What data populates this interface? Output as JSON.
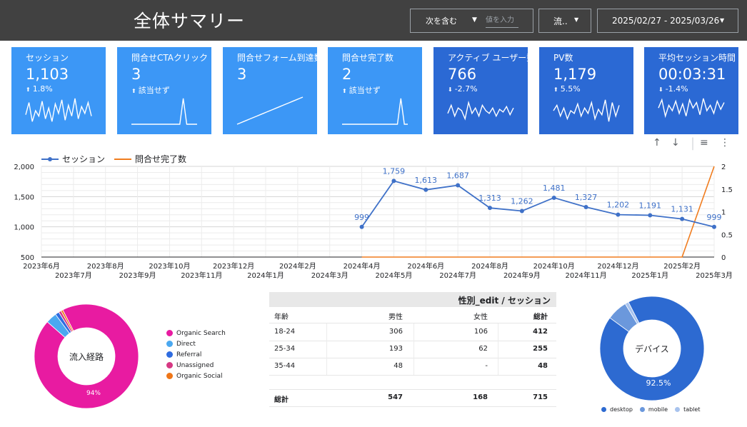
{
  "header": {
    "title": "全体サマリー",
    "filter": {
      "operator": "次を含む",
      "input_placeholder": "値を入力"
    },
    "source_dropdown": "流..",
    "date_range": "2025/02/27 - 2025/03/26"
  },
  "cards": [
    {
      "title": "セッション",
      "value": "1,103",
      "delta": "1.8%",
      "direction": "up",
      "tone": "light"
    },
    {
      "title": "問合せCTAクリック",
      "value": "3",
      "delta": "該当せず",
      "direction": "up",
      "tone": "light"
    },
    {
      "title": "問合せフォーム到達数",
      "value": "3",
      "delta": "",
      "direction": "",
      "tone": "light"
    },
    {
      "title": "問合せ完了数",
      "value": "2",
      "delta": "該当せず",
      "direction": "up",
      "tone": "light"
    },
    {
      "title": "アクティブ ユーザー数",
      "value": "766",
      "delta": "-2.7%",
      "direction": "down",
      "tone": "dark"
    },
    {
      "title": "PV数",
      "value": "1,179",
      "delta": "5.5%",
      "direction": "up",
      "tone": "dark"
    },
    {
      "title": "平均セッション時間",
      "value": "00:03:31",
      "delta": "-1.4%",
      "direction": "down",
      "tone": "dark"
    }
  ],
  "colors": {
    "card_light": "#3c97f6",
    "card_dark": "#2b69d4",
    "session_line": "#3f71c8",
    "completion_line": "#f07c1e",
    "topbar": "#414141",
    "pie_magenta": "#e81ba1",
    "pie_blue": "#2d6ad1"
  },
  "chart_data": [
    {
      "type": "line",
      "title": "",
      "legend_position": "top-left",
      "series": [
        {
          "name": "セッション",
          "axis": "left",
          "x": [
            "2024-04",
            "2024-05",
            "2024-06",
            "2024-07",
            "2024-08",
            "2024-09",
            "2024-10",
            "2024-11",
            "2024-12",
            "2025-01",
            "2025-02",
            "2025-03"
          ],
          "values": [
            999,
            1759,
            1613,
            1687,
            1313,
            1262,
            1481,
            1327,
            1202,
            1191,
            1131,
            999
          ]
        },
        {
          "name": "問合せ完了数",
          "axis": "right",
          "x": [
            "2024-04",
            "2024-05",
            "2024-06",
            "2024-07",
            "2024-08",
            "2024-09",
            "2024-10",
            "2024-11",
            "2024-12",
            "2025-01",
            "2025-02",
            "2025-03"
          ],
          "values": [
            0,
            0,
            0,
            0,
            0,
            0,
            0,
            0,
            0,
            0,
            0,
            2
          ]
        }
      ],
      "x_range": [
        "2023-06",
        "2025-03"
      ],
      "x_ticks_top": [
        "2023年6月",
        "2023年8月",
        "2023年10月",
        "2023年12月",
        "2024年2月",
        "2024年4月",
        "2024年6月",
        "2024年8月",
        "2024年10月",
        "2024年12月",
        "2025年2月"
      ],
      "x_ticks_bottom": [
        "2023年7月",
        "2023年9月",
        "2023年11月",
        "2024年1月",
        "2024年3月",
        "2024年5月",
        "2024年7月",
        "2024年9月",
        "2024年11月",
        "2025年1月",
        "2025年3月"
      ],
      "y_left": {
        "ticks": [
          "500",
          "1,000",
          "1,500",
          "2,000"
        ],
        "ylim": [
          500,
          2000
        ]
      },
      "y_right": {
        "ticks": [
          "0",
          "0.5",
          "1",
          "1.5",
          "2"
        ],
        "ylim": [
          0,
          2
        ]
      },
      "grid": true,
      "data_labels": [
        "999",
        "1,759",
        "1,613",
        "1,687",
        "1,313",
        "1,262",
        "1,481",
        "1,327",
        "1,202",
        "1,191",
        "1,131",
        "999"
      ]
    },
    {
      "type": "pie",
      "title": "流入経路",
      "slices": [
        {
          "label": "Organic Search",
          "value": 94,
          "color": "#e81ba1"
        },
        {
          "label": "Direct",
          "value": 3.4,
          "color": "#4aa8f0"
        },
        {
          "label": "Referral",
          "value": 1.2,
          "color": "#2f6ce0"
        },
        {
          "label": "Unassigned",
          "value": 0.8,
          "color": "#d63883"
        },
        {
          "label": "Organic Social",
          "value": 0.6,
          "color": "#ef7618"
        }
      ],
      "data_label": "94%",
      "legend_position": "right"
    },
    {
      "type": "pie",
      "title": "デバイス",
      "slices": [
        {
          "label": "desktop",
          "value": 92.5,
          "color": "#2d6ad1"
        },
        {
          "label": "mobile",
          "value": 6.4,
          "color": "#6b98dc"
        },
        {
          "label": "tablet",
          "value": 1.1,
          "color": "#a8c3ee"
        }
      ],
      "data_label": "92.5%",
      "legend_position": "bottom"
    },
    {
      "type": "table",
      "title": "性別_edit / セッション",
      "columns": [
        "年齢",
        "男性",
        "女性",
        "総計"
      ],
      "rows": [
        [
          "18-24",
          "306",
          "106",
          "412"
        ],
        [
          "25-34",
          "193",
          "62",
          "255"
        ],
        [
          "35-44",
          "48",
          "-",
          "48"
        ]
      ],
      "total": [
        "総計",
        "547",
        "168",
        "715"
      ]
    }
  ],
  "sparklines": [
    [
      0.35,
      0.8,
      0.1,
      0.5,
      0.3,
      0.85,
      0.2,
      0.6,
      0.1,
      0.75,
      0.4,
      0.9,
      0.15,
      0.7,
      0.3,
      0.95,
      0.2,
      0.65,
      0.4,
      0.8,
      0.3
    ],
    [
      0,
      0,
      0,
      0,
      0,
      0,
      0,
      0,
      0,
      0,
      0,
      0,
      0,
      0,
      0,
      0.95,
      0,
      0,
      0,
      0
    ],
    [
      0,
      0.05,
      0.1,
      0.15,
      0.2,
      0.25,
      0.3,
      0.35,
      0.4,
      0.45,
      0.5,
      0.55,
      0.6,
      0.65,
      0.7,
      0.75,
      0.8,
      0.85,
      0.9,
      0.95,
      1
    ],
    [
      0,
      0,
      0,
      0,
      0,
      0,
      0,
      0,
      0,
      0,
      0,
      0,
      0,
      0,
      0,
      0,
      0,
      0.95,
      0,
      0
    ],
    [
      0.4,
      0.7,
      0.3,
      0.6,
      0.5,
      0.2,
      0.8,
      0.4,
      0.6,
      0.3,
      0.7,
      0.5,
      0.4,
      0.6,
      0.3,
      0.55,
      0.45,
      0.65,
      0.35,
      0.6
    ],
    [
      0.5,
      0.7,
      0.3,
      0.6,
      0.2,
      0.5,
      0.4,
      0.75,
      0.3,
      0.6,
      0.4,
      0.8,
      0.2,
      0.55,
      0.35,
      0.9,
      0.1,
      0.8,
      0.3,
      0.7
    ],
    [
      0.6,
      0.9,
      0.3,
      0.7,
      0.5,
      0.85,
      0.4,
      0.75,
      0.3,
      0.9,
      0.6,
      0.8,
      0.35,
      0.95,
      0.5,
      0.7,
      0.4,
      0.85,
      0.55,
      0.8
    ]
  ]
}
